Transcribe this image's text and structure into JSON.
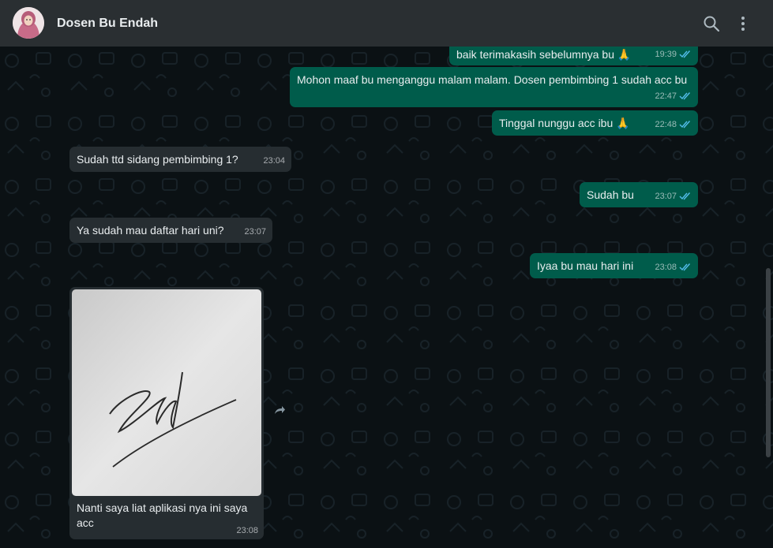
{
  "header": {
    "contact_name": "Dosen Bu Endah",
    "icons": [
      "search-icon",
      "menu-icon"
    ]
  },
  "colors": {
    "header_bg": "#2a2f32",
    "chat_bg": "#0b1114",
    "outgoing_bubble": "#005c4b",
    "incoming_bubble": "#262d31",
    "read_ticks": "#53bdeb"
  },
  "messages": [
    {
      "direction": "out",
      "text": "baik terimakasih sebelumnya bu 🙏",
      "time": "19:39",
      "status": "read"
    },
    {
      "direction": "out",
      "text": "Mohon maaf bu menganggu malam malam. Dosen pembimbing 1 sudah acc bu",
      "time": "22:47",
      "status": "read"
    },
    {
      "direction": "out",
      "text": "Tinggal nunggu acc ibu 🙏",
      "time": "22:48",
      "status": "read"
    },
    {
      "direction": "in",
      "text": "Sudah ttd sidang pembimbing 1?",
      "time": "23:04"
    },
    {
      "direction": "out",
      "text": "Sudah bu",
      "time": "23:07",
      "status": "read"
    },
    {
      "direction": "in",
      "text": "Ya sudah mau daftar hari uni?",
      "time": "23:07"
    },
    {
      "direction": "out",
      "text": "Iyaa bu mau hari ini",
      "time": "23:08",
      "status": "read"
    },
    {
      "direction": "in",
      "type": "image",
      "image": "signature-photo",
      "caption": "Nanti saya liat aplikasi nya  ini saya acc",
      "time": "23:08"
    }
  ]
}
